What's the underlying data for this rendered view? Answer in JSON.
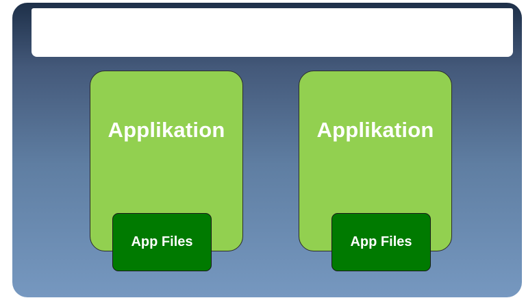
{
  "diagram": {
    "applications": [
      {
        "label": "Applikation",
        "files_label": "App Files"
      },
      {
        "label": "Applikation",
        "files_label": "App Files"
      }
    ],
    "colors": {
      "app_fill": "#92d050",
      "files_fill": "#007a00",
      "container_gradient_top": "#1e3049",
      "container_gradient_bottom": "#7698c0",
      "header_fill": "#ffffff"
    }
  }
}
